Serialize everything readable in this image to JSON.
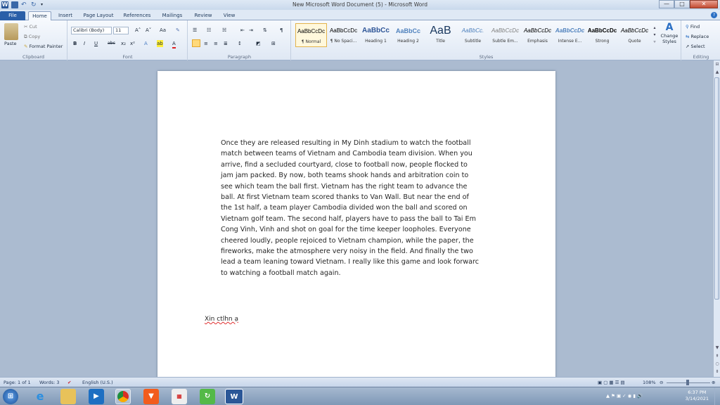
{
  "window": {
    "title": "New Microsoft Word Document (5) - Microsoft Word",
    "app_icon": "W",
    "min_glyph": "—",
    "max_glyph": "□",
    "close_glyph": "✕"
  },
  "tabs": [
    "File",
    "Home",
    "Insert",
    "Page Layout",
    "References",
    "Mailings",
    "Review",
    "View"
  ],
  "ribbon": {
    "clipboard": {
      "paste": "Paste",
      "cut": "Cut",
      "copy": "Copy",
      "format_painter": "Format Painter",
      "label": "Clipboard"
    },
    "font": {
      "family": "Calibri (Body)",
      "size": "11",
      "grow": "A˄",
      "shrink": "A˅",
      "case": "Aa",
      "clear": "✎",
      "bold": "B",
      "italic": "I",
      "underline": "U",
      "strike": "abc",
      "sub": "x₂",
      "sup": "x²",
      "effects": "A",
      "highlight": "ab",
      "color": "A",
      "label": "Font"
    },
    "paragraph": {
      "pilcrow": "¶",
      "label": "Paragraph"
    },
    "styles": {
      "items": [
        {
          "sample": "AaBbCcDc",
          "name": "¶ Normal"
        },
        {
          "sample": "AaBbCcDc",
          "name": "¶ No Spaci..."
        },
        {
          "sample": "AaBbCc",
          "name": "Heading 1"
        },
        {
          "sample": "AaBbCc",
          "name": "Heading 2"
        },
        {
          "sample": "AaB",
          "name": "Title"
        },
        {
          "sample": "AaBbCc.",
          "name": "Subtitle"
        },
        {
          "sample": "AaBbCcDc",
          "name": "Subtle Em..."
        },
        {
          "sample": "AaBbCcDc",
          "name": "Emphasis"
        },
        {
          "sample": "AaBbCcDc",
          "name": "Intense E..."
        },
        {
          "sample": "AaBbCcDc",
          "name": "Strong"
        },
        {
          "sample": "AaBbCcDc",
          "name": "Quote"
        }
      ],
      "change_styles": "Change Styles",
      "label": "Styles"
    },
    "editing": {
      "find": "Find",
      "replace": "Replace",
      "select": "Select",
      "label": "Editing"
    }
  },
  "document": {
    "lines": [
      "Once they are released resulting in My Dinh stadium to watch the football",
      "match between teams of Vietnam and Cambodia team division. When you",
      "arrive, find a secluded courtyard, close to football now, people flocked to",
      "jam jam packed. By now, both teams shook hands and arbitration coin to",
      "see which team the ball first. Vietnam has the right team to advance the",
      "ball. At first Vietnam team scored thanks to Van Wall. But near the end of",
      "the 1st half, a team player Cambodia divided won the ball and scored on",
      "Vietnam golf team. The second half, players have to pass the ball to Tai Em",
      "Cong Vinh, Vinh and shot on goal for the time keeper loopholes. Everyone",
      "cheered loudly, people rejoiced to Vietnam champion, while the paper, the",
      "fireworks, make the atmosphere very noisy in the field. And finally the two",
      "lead a team leaning toward Vietnam. I really like this game and look forwarc",
      "to watching a football match again."
    ],
    "signature": "Xin ctlhn ạ"
  },
  "statusbar": {
    "page": "Page: 1 of 1",
    "words": "Words: 3",
    "language": "English (U.S.)",
    "zoom": "108%"
  },
  "taskbar": {
    "time": "6:37 PM",
    "date": "3/14/2021"
  }
}
